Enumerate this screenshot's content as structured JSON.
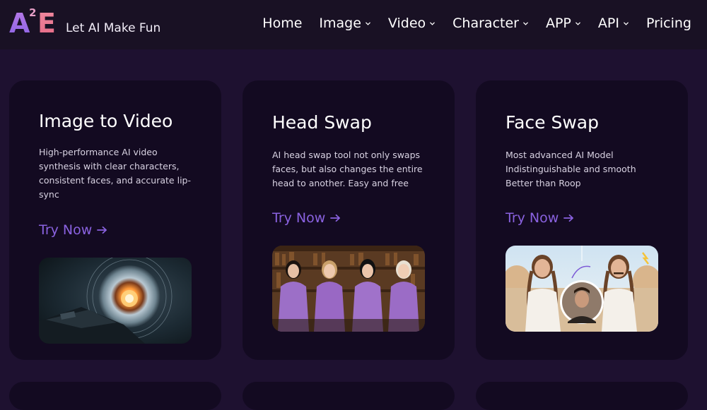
{
  "brand": {
    "logo_letter_a": "A",
    "logo_superscript": "2",
    "logo_letter_e": "E",
    "tagline": "Let AI Make Fun"
  },
  "nav": {
    "items": [
      {
        "label": "Home",
        "has_dropdown": false
      },
      {
        "label": "Image",
        "has_dropdown": true
      },
      {
        "label": "Video",
        "has_dropdown": true
      },
      {
        "label": "Character",
        "has_dropdown": true
      },
      {
        "label": "APP",
        "has_dropdown": true
      },
      {
        "label": "API",
        "has_dropdown": true
      },
      {
        "label": "Pricing",
        "has_dropdown": false
      }
    ]
  },
  "cards": [
    {
      "title": "Image to Video",
      "description": "High-performance AI video synthesis with clear characters, consistent faces, and accurate lip-sync",
      "cta": "Try Now",
      "thumbnail": "glowing-vortex-with-spaceship"
    },
    {
      "title": "Head Swap",
      "description": "AI head swap tool not only swaps faces, but also changes the entire head to another. Easy and free",
      "cta": "Try Now",
      "thumbnail": "four-women-purple-blouses-library"
    },
    {
      "title": "Face Swap",
      "description": "Most advanced AI Model Indistinguishable and smooth Better than Roop",
      "cta": "Try Now",
      "thumbnail": "two-women-braids-with-face-inset"
    }
  ],
  "colors": {
    "page_bg": "#1e1130",
    "header_bg": "#191124",
    "card_bg": "#130a21",
    "accent": "#8a62e0",
    "text": "#ffffff",
    "muted_text": "#d8d2e2"
  }
}
